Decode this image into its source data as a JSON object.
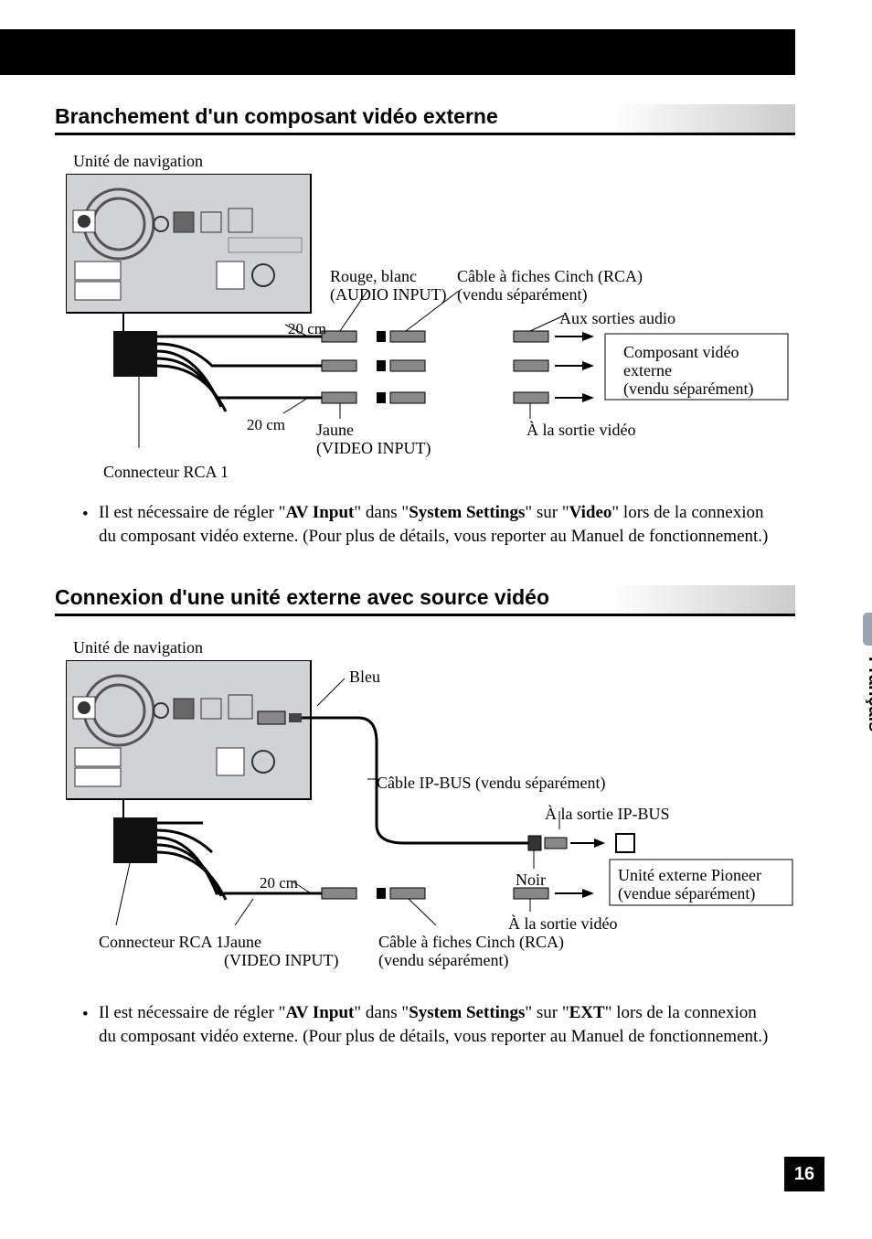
{
  "page_number": "16",
  "side_language": "Français",
  "headings": {
    "h1": "Branchement d'un composant vidéo externe",
    "h2": "Connexion d'une unité externe avec source vidéo"
  },
  "diagram1": {
    "nav_unit": "Unité de navigation",
    "rca_connector": "Connecteur RCA 1",
    "len1": "20 cm",
    "len2": "20 cm",
    "red_white": "Rouge, blanc",
    "audio_input": "(AUDIO INPUT)",
    "yellow": "Jaune",
    "video_input": "(VIDEO INPUT)",
    "rca_cable": "Câble à fiches Cinch (RCA)",
    "sold_sep": "(vendu séparément)",
    "to_audio_out": "Aux sorties audio",
    "to_video_out": "À la sortie vidéo",
    "ext_component_line1": "Composant vidéo",
    "ext_component_line2": "externe",
    "ext_sold_sep": "(vendu séparément)"
  },
  "diagram2": {
    "nav_unit": "Unité de navigation",
    "rca_connector": "Connecteur RCA 1",
    "blue": "Bleu",
    "ipbus_cable": "Câble IP-BUS (vendu séparément)",
    "to_ipbus_out": "À la sortie IP-BUS",
    "len1": "20 cm",
    "yellow": "Jaune",
    "video_input": "(VIDEO INPUT)",
    "rca_cable": "Câble à fiches Cinch (RCA)",
    "sold_sep": "(vendu séparément)",
    "black": "Noir",
    "to_video_out": "À la sortie vidéo",
    "ext_unit_line1": "Unité externe Pioneer",
    "ext_unit_line2": "(vendue séparément)"
  },
  "bullet1": {
    "pre": "Il est nécessaire de régler \"",
    "b1": "AV Input",
    "mid1": "\" dans \"",
    "b2": "System Settings",
    "mid2": "\" sur \"",
    "b3": "Video",
    "post": "\" lors de la connexion du composant vidéo externe. (Pour plus de détails, vous reporter au Manuel de fonctionnement.)"
  },
  "bullet2": {
    "pre": "Il est nécessaire de régler \"",
    "b1": "AV Input",
    "mid1": "\" dans \"",
    "b2": "System Settings",
    "mid2": "\" sur \"",
    "b3": "EXT",
    "post": "\" lors de la connexion du composant vidéo externe. (Pour plus de détails, vous reporter au Manuel de fonctionnement.)"
  }
}
